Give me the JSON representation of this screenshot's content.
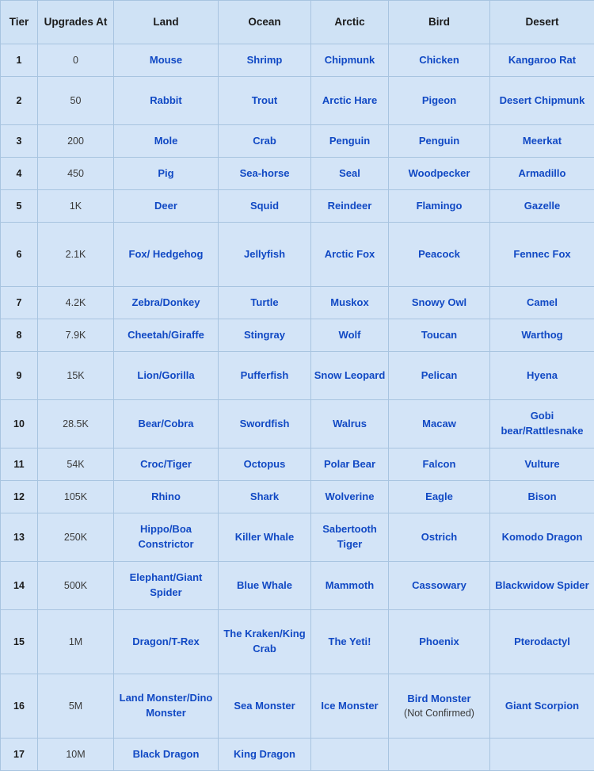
{
  "table": {
    "columns": [
      {
        "key": "tier",
        "label": "Tier"
      },
      {
        "key": "upg",
        "label": "Upgrades At"
      },
      {
        "key": "land",
        "label": "Land"
      },
      {
        "key": "ocean",
        "label": "Ocean"
      },
      {
        "key": "arctic",
        "label": "Arctic"
      },
      {
        "key": "bird",
        "label": "Bird"
      },
      {
        "key": "desert",
        "label": "Desert"
      }
    ],
    "rows": [
      {
        "tier": "1",
        "upg": "0",
        "land": "Mouse",
        "ocean": "Shrimp",
        "arctic": "Chipmunk",
        "bird": "Chicken",
        "desert": "Kangaroo Rat"
      },
      {
        "tier": "2",
        "upg": "50",
        "land": "Rabbit",
        "ocean": "Trout",
        "arctic": "Arctic Hare",
        "bird": "Pigeon",
        "desert": "Desert Chipmunk"
      },
      {
        "tier": "3",
        "upg": "200",
        "land": "Mole",
        "ocean": "Crab",
        "arctic": "Penguin",
        "bird": "Penguin",
        "desert": "Meerkat"
      },
      {
        "tier": "4",
        "upg": "450",
        "land": "Pig",
        "ocean": "Sea-horse",
        "arctic": "Seal",
        "bird": "Woodpecker",
        "desert": "Armadillo"
      },
      {
        "tier": "5",
        "upg": "1K",
        "land": "Deer",
        "ocean": "Squid",
        "arctic": "Reindeer",
        "bird": "Flamingo",
        "desert": "Gazelle"
      },
      {
        "tier": "6",
        "upg": "2.1K",
        "land": "Fox/ Hedgehog",
        "ocean": "Jellyfish",
        "arctic": "Arctic Fox",
        "bird": "Peacock",
        "desert": "Fennec Fox"
      },
      {
        "tier": "7",
        "upg": "4.2K",
        "land": "Zebra/Donkey",
        "ocean": "Turtle",
        "arctic": "Muskox",
        "bird": "Snowy Owl",
        "desert": "Camel"
      },
      {
        "tier": "8",
        "upg": "7.9K",
        "land": "Cheetah/Giraffe",
        "ocean": "Stingray",
        "arctic": "Wolf",
        "bird": "Toucan",
        "desert": "Warthog"
      },
      {
        "tier": "9",
        "upg": "15K",
        "land": "Lion/Gorilla",
        "ocean": "Pufferfish",
        "arctic": "Snow Leopard",
        "bird": "Pelican",
        "desert": "Hyena"
      },
      {
        "tier": "10",
        "upg": "28.5K",
        "land": "Bear/Cobra",
        "ocean": "Swordfish",
        "arctic": "Walrus",
        "bird": "Macaw",
        "desert": "Gobi bear/Rattlesnake"
      },
      {
        "tier": "11",
        "upg": "54K",
        "land": "Croc/Tiger",
        "ocean": "Octopus",
        "arctic": "Polar Bear",
        "bird": "Falcon",
        "desert": "Vulture"
      },
      {
        "tier": "12",
        "upg": "105K",
        "land": "Rhino",
        "ocean": "Shark",
        "arctic": "Wolverine",
        "bird": "Eagle",
        "desert": "Bison"
      },
      {
        "tier": "13",
        "upg": "250K",
        "land": "Hippo/Boa Constrictor",
        "ocean": "Killer Whale",
        "arctic": "Sabertooth Tiger",
        "bird": "Ostrich",
        "desert": "Komodo Dragon"
      },
      {
        "tier": "14",
        "upg": "500K",
        "land": "Elephant/Giant Spider",
        "ocean": "Blue Whale",
        "arctic": "Mammoth",
        "bird": "Cassowary",
        "desert": "Blackwidow Spider"
      },
      {
        "tier": "15",
        "upg": "1M",
        "land": "Dragon/T-Rex",
        "ocean": "The Kraken/King Crab",
        "arctic": "The Yeti!",
        "bird": "Phoenix",
        "desert": "Pterodactyl"
      },
      {
        "tier": "16",
        "upg": "5M",
        "land": "Land Monster/Dino Monster",
        "ocean": "Sea Monster",
        "arctic": "Ice Monster",
        "bird": "Bird Monster",
        "bird_note": "(Not Confirmed)",
        "desert": "Giant Scorpion"
      },
      {
        "tier": "17",
        "upg": "10M",
        "land": "Black Dragon",
        "ocean": "King Dragon",
        "arctic": "",
        "bird": "",
        "desert": ""
      }
    ],
    "row_heights": [
      "r-short",
      "r-tall",
      "r-short",
      "r-short",
      "r-short",
      "r-xtall",
      "r-short",
      "r-short",
      "r-tall",
      "r-tall",
      "r-short",
      "r-short",
      "r-tall",
      "r-tall",
      "r-xtall",
      "r-xtall",
      "r-short"
    ],
    "empty_cells": {
      "17": [
        "arctic",
        "bird",
        "desert"
      ]
    }
  },
  "colors": {
    "cell_background": "#d3e4f7",
    "tier_background": "#c9dff4",
    "header_background": "#cfe2f5",
    "grid_line": "#a8c4e0",
    "name_text": "#1149c4",
    "header_text": "#1b1b1b",
    "note_text": "#3a3a3a"
  }
}
